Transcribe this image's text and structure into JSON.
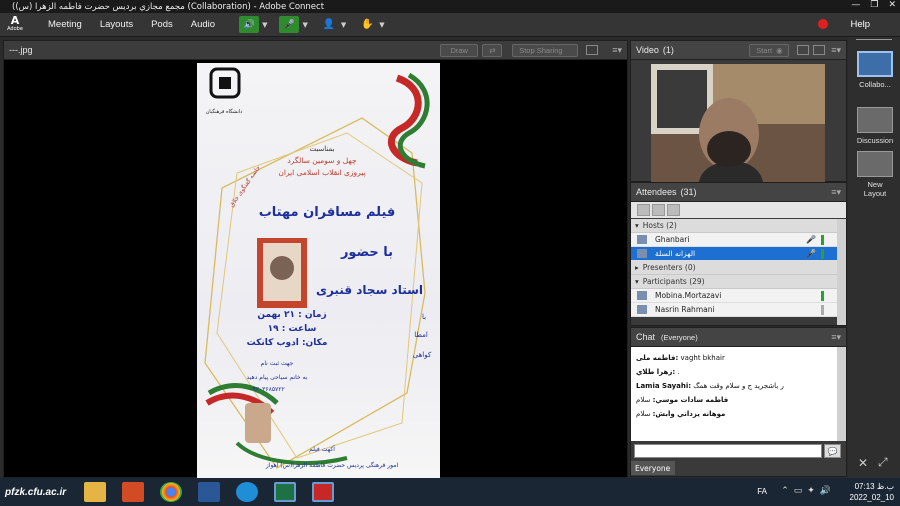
{
  "window": {
    "title": "(مجمع مجازي برديس حضرت فاطمه الزهرا (س) (Collaboration) - Adobe Connect",
    "controls": [
      "—",
      "❐",
      "✕"
    ]
  },
  "menubar": {
    "logo_text": "A",
    "logo_caption": "Adobe",
    "items": [
      "Meeting",
      "Layouts",
      "Pods",
      "Audio"
    ],
    "help": "Help"
  },
  "share_pod": {
    "title": "---.jpg",
    "buttons": [
      "Draw",
      "Stop Sharing"
    ]
  },
  "poster": {
    "univ": "دانشگاه فرهنگیان",
    "occasion_1": "بمناسبت",
    "occasion_2": "چهل و سومین سالگرد",
    "occasion_3": "پیروزی انقلاب اسلامی ایران",
    "diagonal": "جلسه گفتگوی خلاق",
    "film_title": "فیلم مسافران مهتاب",
    "with_presence": "با حضور",
    "director": "استاد سجاد قنبری",
    "time_line_1": "زمان : ۲۱ بهمن",
    "time_line_2": "ساعت : ۱۹",
    "place": "مکان: ادوب کانکت",
    "side_1": "با",
    "side_2": "امطا",
    "side_3": "کواهی",
    "reg_1": "جهت ثبت نام",
    "reg_2": "به خانم سیاحی پیام دهید",
    "phone": "۰۹۳۰۳۶۸۵۷۲۲",
    "footer_1": "آکهت فیلم",
    "footer_2": "امور فرهنگی پردیس حضرت فاطمه الزهرا(س) اهواز"
  },
  "video_pod": {
    "title": "Video",
    "count": "(1)",
    "start_label": "Start"
  },
  "attendees_pod": {
    "title": "Attendees",
    "count": "(31)",
    "hosts_label": "Hosts (2)",
    "presenters_label": "Presenters (0)",
    "participants_label": "Participants (29)",
    "hosts": [
      {
        "name": "Ghanbari",
        "selected": false
      },
      {
        "name": "الهزانه السلة",
        "selected": true
      }
    ],
    "participants": [
      {
        "name": "Mobina.Mortazavi"
      },
      {
        "name": "Nasrin Rahmani"
      }
    ]
  },
  "chat_pod": {
    "title": "Chat",
    "scope": "(Everyone)",
    "messages": [
      {
        "sender": "فاطمه ملی:",
        "text": "vaght bkhair"
      },
      {
        "sender": "زهرا طلاي:",
        "text": "."
      },
      {
        "sender": "Lamia Sayahi:",
        "text": "ر باشجرید ج و سلام وقت همگ"
      },
      {
        "sender": "فاطمه سادات موسي:",
        "text": "سلام"
      },
      {
        "sender": "موهانه يزداني وابش:",
        "text": "سلام"
      }
    ],
    "tab_label": "Everyone"
  },
  "layouts": [
    {
      "label": "Collabo...",
      "active": true
    },
    {
      "label": "Discussion",
      "active": false
    },
    {
      "label": "New Layout",
      "active": false
    }
  ],
  "taskbar": {
    "brand": "pfzk.cfu.ac.ir",
    "lang": "FA",
    "time": "07:13 ب.ظ",
    "date": "2022_02_10"
  }
}
